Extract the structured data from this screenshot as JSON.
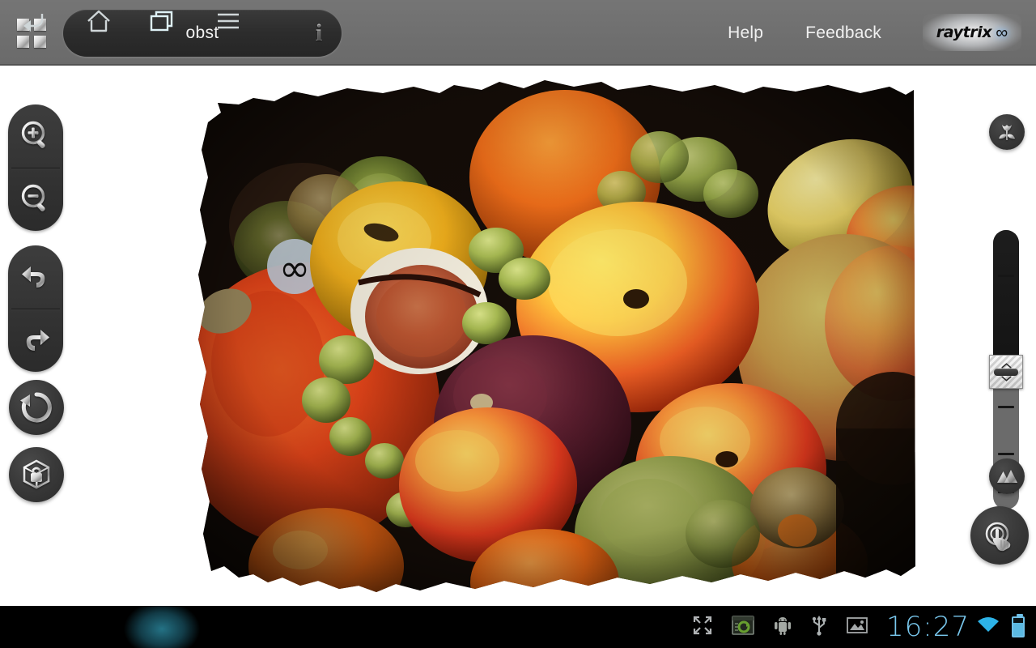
{
  "app": {
    "title": "obst",
    "brand_name": "raytrix",
    "brand_symbol": "∞"
  },
  "topbar": {
    "grid_icon": "grid-apps-icon",
    "info_icon": "i",
    "links": [
      {
        "label": "Help",
        "name": "help-link"
      },
      {
        "label": "Feedback",
        "name": "feedback-link"
      }
    ]
  },
  "left_toolbar": {
    "items": [
      {
        "name": "zoom-in-button",
        "icon": "magnifier-plus-icon",
        "label": "Zoom In"
      },
      {
        "name": "zoom-out-button",
        "icon": "magnifier-minus-icon",
        "label": "Zoom Out"
      },
      {
        "name": "undo-button",
        "icon": "undo-arrow-icon",
        "label": "Undo"
      },
      {
        "name": "redo-button",
        "icon": "redo-arrow-icon",
        "label": "Redo"
      },
      {
        "name": "reset-view-button",
        "icon": "circular-reset-arrow-icon",
        "label": "Reset"
      },
      {
        "name": "lock-volume-button",
        "icon": "cube-lock-icon",
        "label": "Lock"
      }
    ]
  },
  "right_controls": {
    "macro_focus": {
      "name": "macro-focus-button",
      "icon": "tulip-flower-icon",
      "label": "Macro Focus"
    },
    "landscape_focus": {
      "name": "landscape-focus-button",
      "icon": "mountains-icon",
      "label": "Landscape Focus"
    },
    "touch_focus": {
      "name": "touch-focus-button",
      "icon": "hand-touch-focus-icon",
      "label": "Touch Focus"
    },
    "focus_slider": {
      "name": "focus-depth-slider",
      "value_percent": 48,
      "orientation": "vertical",
      "ticks": 5
    }
  },
  "viewport": {
    "name": "lightfield-image-viewport",
    "image_label": "obst",
    "background_color": "#ffffff",
    "photo_backdrop_color": "#140c08",
    "watermark_symbol": "∞"
  },
  "system_bar": {
    "nav": [
      {
        "name": "android-back-button",
        "icon": "back-arrow-icon"
      },
      {
        "name": "android-home-button",
        "icon": "home-icon"
      },
      {
        "name": "android-recents-button",
        "icon": "recent-apps-icon",
        "active": true
      },
      {
        "name": "android-menu-button",
        "icon": "hamburger-menu-icon"
      }
    ],
    "tray": [
      {
        "name": "fullscreen-icon",
        "icon": "expand-arrows-icon"
      },
      {
        "name": "screen-capture-icon",
        "icon": "window-sync-icon"
      },
      {
        "name": "android-debug-icon",
        "icon": "android-robot-icon"
      },
      {
        "name": "usb-icon",
        "icon": "usb-trident-icon"
      },
      {
        "name": "gallery-icon",
        "icon": "picture-frame-icon"
      }
    ],
    "clock": "16:27",
    "wifi": "wifi-full-icon",
    "battery": "battery-icon",
    "clock_color": "#79c8ee"
  }
}
